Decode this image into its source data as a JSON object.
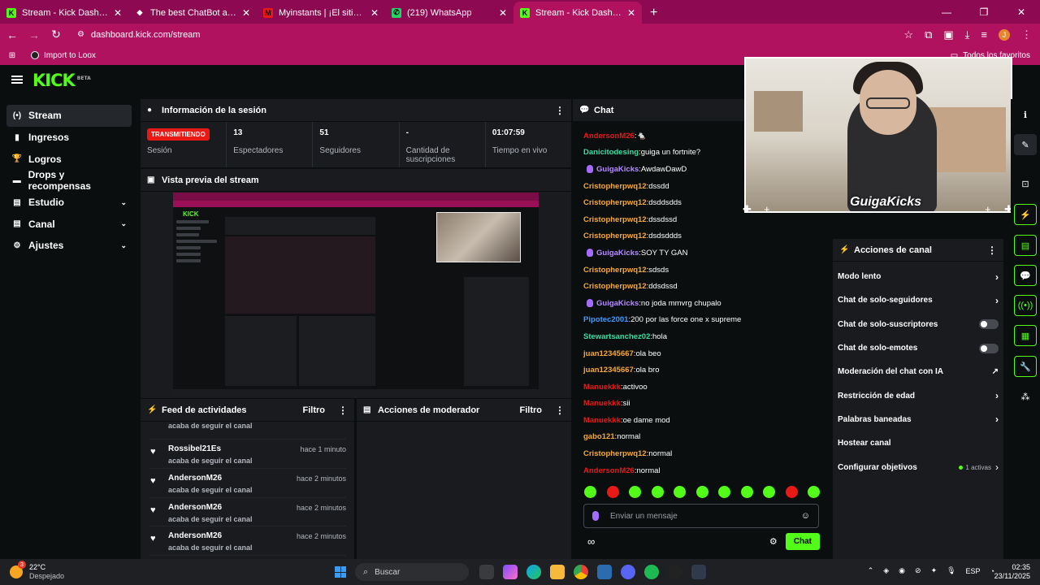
{
  "browser": {
    "tabs": [
      {
        "title": "Stream - Kick Dashboard",
        "fav_color": "#53fc18",
        "fav": "K"
      },
      {
        "title": "The best ChatBot and Widgets",
        "fav_color": "#ffffff",
        "fav": "◆"
      },
      {
        "title": "Myinstants | ¡El sitio web de bo",
        "fav_color": "#e91916",
        "fav": "M"
      },
      {
        "title": "(219) WhatsApp",
        "fav_color": "#25d366",
        "fav": "✆"
      },
      {
        "title": "Stream - Kick Dashboard",
        "fav_color": "#53fc18",
        "fav": "K"
      }
    ],
    "new_tab": "+",
    "url": "dashboard.kick.com/stream",
    "bookmark": "Import to Loox",
    "all_bookmarks": "Todos los favoritos",
    "profile_initial": "J"
  },
  "kick": {
    "logo": "KICK",
    "logo_tag": "BETA",
    "sidebar": [
      {
        "label": "Stream",
        "icon": "(•)"
      },
      {
        "label": "Ingresos",
        "icon": "▮"
      },
      {
        "label": "Logros",
        "icon": "🏆"
      },
      {
        "label": "Drops y recompensas",
        "icon": "▬"
      },
      {
        "label": "Estudio",
        "icon": "▤"
      },
      {
        "label": "Canal",
        "icon": "▤"
      },
      {
        "label": "Ajustes",
        "icon": "⚙"
      }
    ],
    "session": {
      "title": "Información de la sesión",
      "status": "TRANSMITIENDO",
      "status_label": "Sesión",
      "stats": [
        {
          "value": "13",
          "label": "Espectadores"
        },
        {
          "value": "51",
          "label": "Seguidores"
        },
        {
          "value": "-",
          "label": "Cantidad de suscripciones"
        },
        {
          "value": "01:07:59",
          "label": "Tiempo en vivo"
        }
      ]
    },
    "preview": {
      "title": "Vista previa del stream"
    },
    "feed": {
      "title": "Feed de actividades",
      "filter": "Filtro",
      "items": [
        {
          "user": "",
          "action": "acaba de seguir el canal",
          "time": ""
        },
        {
          "user": "Rossibel21Es",
          "action": "acaba de seguir el canal",
          "time": "hace 1 minuto"
        },
        {
          "user": "AndersonM26",
          "action": "acaba de seguir el canal",
          "time": "hace 2 minutos"
        },
        {
          "user": "AndersonM26",
          "action": "acaba de seguir el canal",
          "time": "hace 2 minutos"
        },
        {
          "user": "AndersonM26",
          "action": "acaba de seguir el canal",
          "time": "hace 2 minutos"
        }
      ]
    },
    "mod": {
      "title": "Acciones de moderador",
      "filter": "Filtro"
    },
    "chat": {
      "title": "Chat",
      "messages": [
        {
          "user": "AndersonM26",
          "color": "#e91916",
          "text": " 🐁",
          "badge": false
        },
        {
          "user": "Danicitodesing",
          "color": "#35e0a0",
          "text": " guiga un fortnite?",
          "badge": false
        },
        {
          "user": "GuigaKicks",
          "color": "#b48cff",
          "text": " AwdawDawD",
          "badge": true
        },
        {
          "user": "Cristopherpwq12",
          "color": "#f5a93b",
          "text": " dssdd",
          "badge": false
        },
        {
          "user": "Cristopherpwq12",
          "color": "#f5a93b",
          "text": " dsddsdds",
          "badge": false
        },
        {
          "user": "Cristopherpwq12",
          "color": "#f5a93b",
          "text": " dssdssd",
          "badge": false
        },
        {
          "user": "Cristopherpwq12",
          "color": "#f5a93b",
          "text": " dsdsddds",
          "badge": false
        },
        {
          "user": "GuigaKicks",
          "color": "#b48cff",
          "text": " SOY TY GAN",
          "badge": true
        },
        {
          "user": "Cristopherpwq12",
          "color": "#f5a93b",
          "text": " sdsds",
          "badge": false
        },
        {
          "user": "Cristopherpwq12",
          "color": "#f5a93b",
          "text": " ddsdssd",
          "badge": false
        },
        {
          "user": "GuigaKicks",
          "color": "#b48cff",
          "text": " no joda mmvrg chupalo",
          "badge": true
        },
        {
          "user": "Pipotec2001",
          "color": "#3d9bff",
          "text": " 200 por las force one x supreme",
          "badge": false
        },
        {
          "user": "Stewartsanchez02",
          "color": "#35e0a0",
          "text": " hola",
          "badge": false
        },
        {
          "user": "juan12345667",
          "color": "#f5a93b",
          "text": " ola beo",
          "badge": false
        },
        {
          "user": "juan12345667",
          "color": "#f5a93b",
          "text": " ola bro",
          "badge": false
        },
        {
          "user": "Manuekkk",
          "color": "#e91916",
          "text": " activoo",
          "badge": false
        },
        {
          "user": "Manuekkk",
          "color": "#e91916",
          "text": " sii",
          "badge": false
        },
        {
          "user": "Manuekkk",
          "color": "#e91916",
          "text": " oe dame mod",
          "badge": false
        },
        {
          "user": "gabo121",
          "color": "#f5a93b",
          "text": " normal",
          "badge": false
        },
        {
          "user": "Cristopherpwq12",
          "color": "#f5a93b",
          "text": " normal",
          "badge": false
        },
        {
          "user": "AndersonM26",
          "color": "#e91916",
          "text": " normal",
          "badge": false
        }
      ],
      "placeholder": "Enviar un mensaje",
      "send": "Chat"
    },
    "channel_actions": {
      "title": "Acciones de canal",
      "rows": [
        {
          "label": "Modo lento",
          "kind": "arrow"
        },
        {
          "label": "Chat de solo-seguidores",
          "kind": "arrow"
        },
        {
          "label": "Chat de solo-suscriptores",
          "kind": "toggle"
        },
        {
          "label": "Chat de solo-emotes",
          "kind": "toggle"
        },
        {
          "label": "Moderación del chat con IA",
          "kind": "ext"
        },
        {
          "label": "Restricción de edad",
          "kind": "arrow"
        },
        {
          "label": "Palabras baneadas",
          "kind": "arrow"
        },
        {
          "label": "Hostear canal",
          "kind": "none"
        },
        {
          "label": "Configurar objetivos",
          "kind": "objs"
        }
      ],
      "objs_label": "1 activas"
    },
    "cam_overlay": "GuigaKicks"
  },
  "taskbar": {
    "temp": "22°C",
    "weather": "Despejado",
    "weather_badge": "3",
    "search": "Buscar",
    "lang": "ESP",
    "time": "02:35",
    "date": "23/11/2025"
  }
}
